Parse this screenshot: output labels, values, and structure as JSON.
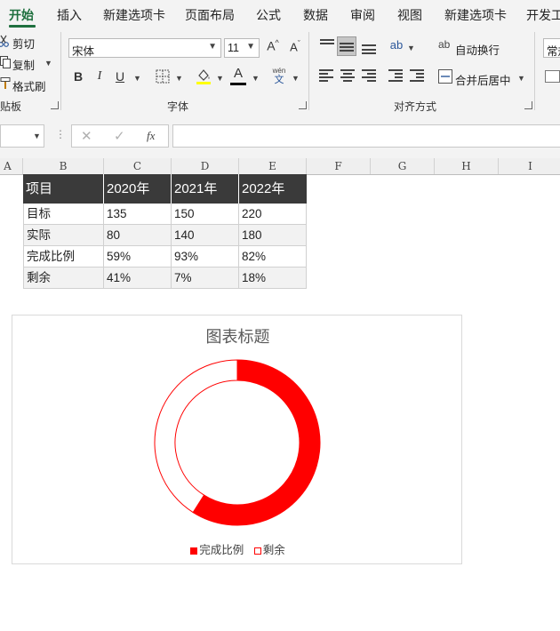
{
  "ribbon_tabs": [
    "开始",
    "插入",
    "新建选项卡",
    "页面布局",
    "公式",
    "数据",
    "审阅",
    "视图",
    "新建选项卡",
    "开发工"
  ],
  "clipboard": {
    "cut": "剪切",
    "copy": "复制",
    "format_painter": "格式刷",
    "group_label": "贴板"
  },
  "font": {
    "family": "宋体",
    "size": "11",
    "group_label": "字体",
    "grow_icon": "A^",
    "shrink_icon": "Aˇ",
    "bold": "B",
    "italic": "I",
    "underline": "U",
    "fill_icon": "fill-color",
    "font_color_icon": "A",
    "wen_top": "wén",
    "wen_bottom": "文",
    "font_color": "#000000"
  },
  "alignment": {
    "wrap_text": "自动换行",
    "merge_center": "合并后居中",
    "group_label": "对齐方式"
  },
  "number": {
    "format_partial": "常规"
  },
  "formula_bar": {
    "cancel": "✕",
    "enter": "✓",
    "fx": "fx",
    "name_value": "",
    "formula_value": ""
  },
  "columns": [
    "A",
    "B",
    "C",
    "D",
    "E",
    "F",
    "G",
    "H",
    "I"
  ],
  "table": {
    "headers": [
      "项目",
      "2020年",
      "2021年",
      "2022年"
    ],
    "rows": [
      [
        "目标",
        "135",
        "150",
        "220"
      ],
      [
        "实际",
        "80",
        "140",
        "180"
      ],
      [
        "完成比例",
        "59%",
        "93%",
        "82%"
      ],
      [
        "剩余",
        "41%",
        "7%",
        "18%"
      ]
    ]
  },
  "chart_data": {
    "type": "pie",
    "variant": "doughnut",
    "title": "图表标题",
    "categories": [
      "完成比例",
      "剩余"
    ],
    "values": [
      59,
      41
    ],
    "colors": [
      "#ff0000",
      "#ffffff"
    ],
    "legend_position": "bottom"
  }
}
